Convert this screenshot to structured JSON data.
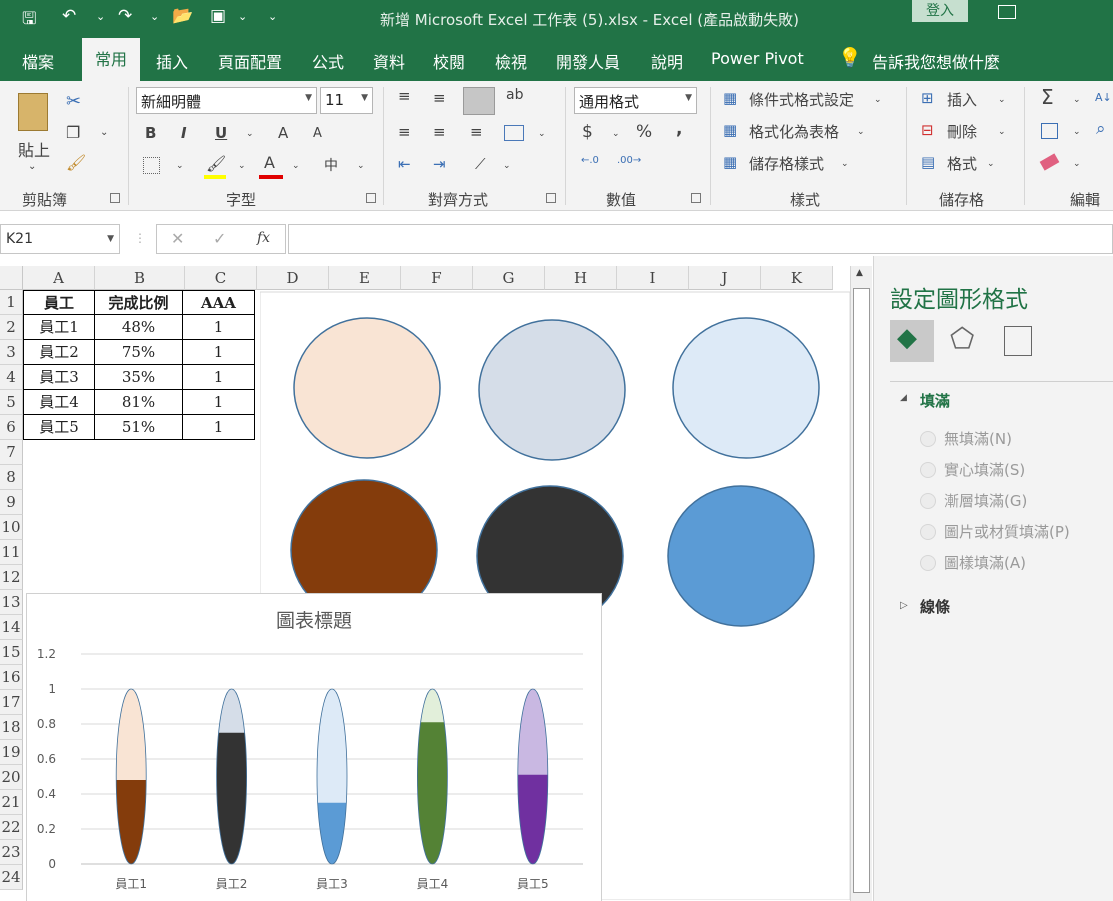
{
  "window": {
    "title": "新增 Microsoft Excel 工作表 (5).xlsx  -  Excel (產品啟動失敗)",
    "login_label": "登入"
  },
  "menu": {
    "items": [
      "檔案",
      "常用",
      "插入",
      "頁面配置",
      "公式",
      "資料",
      "校閱",
      "檢視",
      "開發人員",
      "說明",
      "Power Pivot"
    ],
    "tell_me": "告訴我您想做什麼"
  },
  "ribbon": {
    "clipboard": {
      "paste_label": "貼上",
      "group_label": "剪貼簿"
    },
    "font": {
      "name": "新細明體",
      "size": "11",
      "bold": "B",
      "italic": "I",
      "underline": "U",
      "grow": "A",
      "shrink": "A",
      "phonetic": "中",
      "group_label": "字型"
    },
    "alignment": {
      "group_label": "對齊方式"
    },
    "number": {
      "format": "通用格式",
      "currency": "$",
      "percent": "%",
      "comma": ",",
      "group_label": "數值"
    },
    "styles": {
      "conditional": "條件式格式設定",
      "as_table": "格式化為表格",
      "cell_styles": "儲存格樣式",
      "group_label": "樣式"
    },
    "cells": {
      "insert": "插入",
      "delete": "刪除",
      "format": "格式",
      "group_label": "儲存格"
    },
    "editing": {
      "sigma": "Σ",
      "group_label": "編輯"
    }
  },
  "formula_bar": {
    "name_box": "K21",
    "fx": "fx",
    "formula": ""
  },
  "sheet": {
    "columns": [
      "A",
      "B",
      "C",
      "D",
      "E",
      "F",
      "G",
      "H",
      "I",
      "J",
      "K"
    ],
    "rows": [
      "1",
      "2",
      "3",
      "4",
      "5",
      "6",
      "7",
      "8",
      "9",
      "10",
      "11",
      "12",
      "13",
      "14",
      "15",
      "16",
      "17",
      "18",
      "19",
      "20",
      "21",
      "22",
      "23",
      "24"
    ],
    "table": {
      "headers": [
        "員工",
        "完成比例",
        "AAA"
      ],
      "rows": [
        [
          "員工1",
          "48%",
          "1"
        ],
        [
          "員工2",
          "75%",
          "1"
        ],
        [
          "員工3",
          "35%",
          "1"
        ],
        [
          "員工4",
          "81%",
          "1"
        ],
        [
          "員工5",
          "51%",
          "1"
        ]
      ]
    }
  },
  "circles": {
    "top_colors": [
      "#f9e4d4",
      "#d5dde8",
      "#ddeaf7"
    ],
    "bottom_colors": [
      "#843c0c",
      "#333333",
      "#5b9bd5"
    ],
    "outline": "#41719c"
  },
  "chart_data": {
    "type": "bar",
    "title": "圖表標題",
    "categories": [
      "員工1",
      "員工2",
      "員工3",
      "員工4",
      "員工5"
    ],
    "series": [
      {
        "name": "完成比例",
        "values": [
          0.48,
          0.75,
          0.35,
          0.81,
          0.51
        ]
      },
      {
        "name": "AAA",
        "values": [
          1,
          1,
          1,
          1,
          1
        ]
      }
    ],
    "ylim": [
      0,
      1.2
    ],
    "yticks": [
      "0",
      "0.2",
      "0.4",
      "0.6",
      "0.8",
      "1",
      "1.2"
    ],
    "grid": true,
    "fill_colors": [
      "#843c0c",
      "#333333",
      "#5b9bd5",
      "#548235",
      "#7030a0"
    ],
    "background_colors": [
      "#f9e4d4",
      "#d5dde8",
      "#ddeaf7",
      "#e2efda",
      "#c9b8e2"
    ]
  },
  "format_pane": {
    "title": "設定圖形格式",
    "section_fill": "填滿",
    "options": [
      "無填滿(N)",
      "實心填滿(S)",
      "漸層填滿(G)",
      "圖片或材質填滿(P)",
      "圖樣填滿(A)"
    ],
    "section_line": "線條"
  }
}
